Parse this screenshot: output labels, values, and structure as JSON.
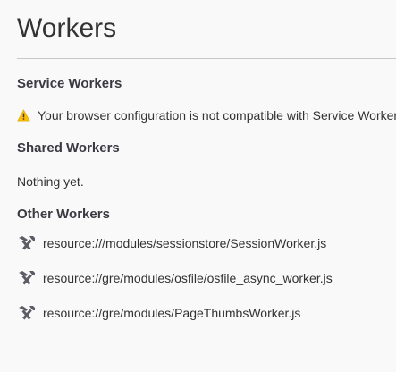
{
  "page": {
    "title": "Workers"
  },
  "sections": {
    "service": {
      "heading": "Service Workers",
      "warning": "Your browser configuration is not compatible with Service Workers."
    },
    "shared": {
      "heading": "Shared Workers",
      "empty_text": "Nothing yet."
    },
    "other": {
      "heading": "Other Workers",
      "items": [
        {
          "url": "resource:///modules/sessionstore/SessionWorker.js",
          "icon": "tools-icon"
        },
        {
          "url": "resource://gre/modules/osfile/osfile_async_worker.js",
          "icon": "tools-icon"
        },
        {
          "url": "resource://gre/modules/PageThumbsWorker.js",
          "icon": "tools-icon"
        }
      ]
    }
  },
  "colors": {
    "warning": "#ffbf00",
    "icon": "#5c5c66"
  }
}
